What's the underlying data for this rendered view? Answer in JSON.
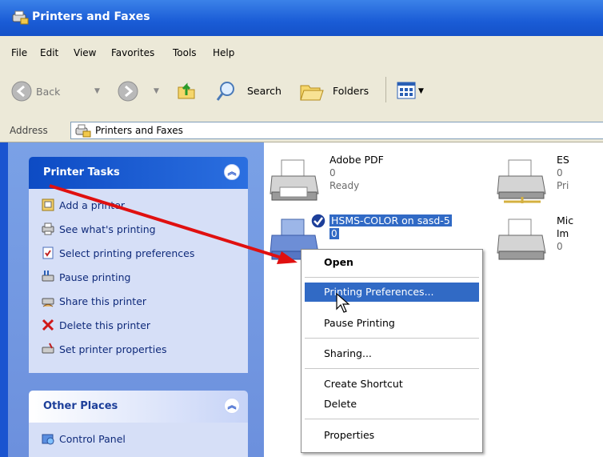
{
  "window": {
    "title": "Printers and Faxes"
  },
  "menu": [
    "File",
    "Edit",
    "View",
    "Favorites",
    "Tools",
    "Help"
  ],
  "toolbar": {
    "back": "Back",
    "search": "Search",
    "folders": "Folders"
  },
  "address": {
    "label": "Address",
    "value": "Printers and Faxes"
  },
  "printer_tasks": {
    "header": "Printer Tasks",
    "items": [
      "Add a printer",
      "See what's printing",
      "Select printing preferences",
      "Pause printing",
      "Share this printer",
      "Delete this printer",
      "Set printer properties"
    ]
  },
  "other_places": {
    "header": "Other Places",
    "items": [
      "Control Panel"
    ]
  },
  "printers": [
    {
      "name": "Adobe PDF",
      "docs": "0",
      "status": "Ready"
    },
    {
      "name": "HSMS-COLOR on sasd-5",
      "docs": "0",
      "status": ""
    },
    {
      "name": "ES",
      "docs": "0",
      "status": "Pri"
    },
    {
      "name": "Mic",
      "docs": "Im",
      "status": "0"
    }
  ],
  "context_menu": {
    "open": "Open",
    "printing_preferences": "Printing Preferences...",
    "pause_printing": "Pause Printing",
    "sharing": "Sharing...",
    "create_shortcut": "Create Shortcut",
    "delete": "Delete",
    "properties": "Properties"
  },
  "colors": {
    "titlebar": "#1a5cd6",
    "selection": "#316ac5",
    "arrow": "#e01010"
  }
}
